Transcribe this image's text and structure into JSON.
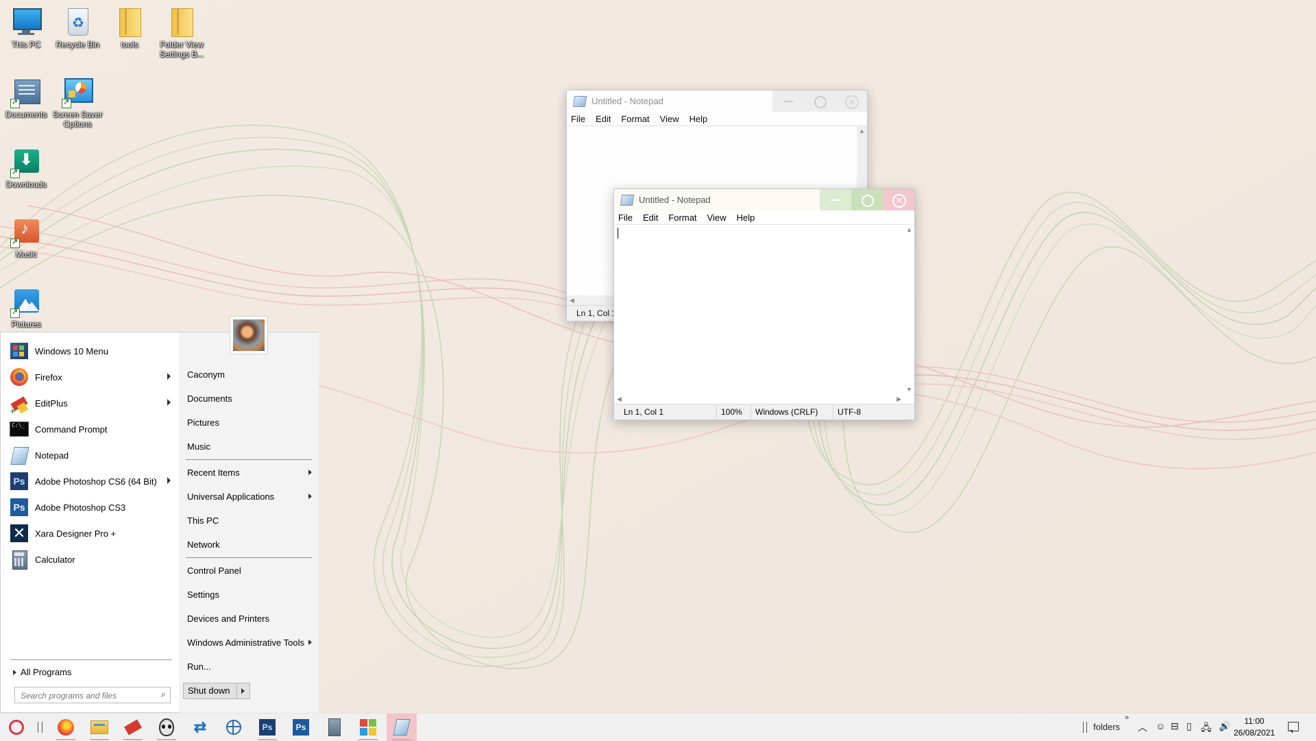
{
  "desktop_icons": [
    {
      "label": "This PC",
      "icon": "monitor-icon"
    },
    {
      "label": "Recycle Bin",
      "icon": "recycle-bin-icon"
    },
    {
      "label": "tools",
      "icon": "folder-icon"
    },
    {
      "label": "Folder View Settings B...",
      "icon": "folder-icon"
    },
    {
      "label": "Documents",
      "icon": "documents-icon"
    },
    {
      "label": "Screen Saver Options",
      "icon": "screen-saver-icon"
    },
    {
      "label": "Downloads",
      "icon": "downloads-icon"
    },
    {
      "label": "Music",
      "icon": "music-icon"
    },
    {
      "label": "Pictures",
      "icon": "pictures-icon"
    }
  ],
  "notepad_back": {
    "title": "Untitled - Notepad",
    "menu": [
      "File",
      "Edit",
      "Format",
      "View",
      "Help"
    ],
    "status_partial": "Ln 1, Col 1"
  },
  "notepad_front": {
    "title": "Untitled - Notepad",
    "menu": [
      "File",
      "Edit",
      "Format",
      "View",
      "Help"
    ],
    "status": {
      "position": "Ln 1, Col 1",
      "zoom": "100%",
      "line_ending": "Windows (CRLF)",
      "encoding": "UTF-8"
    }
  },
  "start_menu": {
    "programs": [
      {
        "label": "Windows 10 Menu",
        "icon": "windows-10-menu-icon",
        "submenu": false
      },
      {
        "label": "Firefox",
        "icon": "firefox-icon",
        "submenu": true
      },
      {
        "label": "EditPlus",
        "icon": "editplus-icon",
        "submenu": true
      },
      {
        "label": "Command Prompt",
        "icon": "command-prompt-icon",
        "submenu": false
      },
      {
        "label": "Notepad",
        "icon": "notepad-icon",
        "submenu": false
      },
      {
        "label": "Adobe Photoshop CS6 (64 Bit)",
        "icon": "photoshop-icon",
        "submenu": true
      },
      {
        "label": "Adobe Photoshop CS3",
        "icon": "photoshop-icon",
        "submenu": false
      },
      {
        "label": "Xara Designer Pro +",
        "icon": "xara-icon",
        "submenu": false
      },
      {
        "label": "Calculator",
        "icon": "calculator-icon",
        "submenu": false
      }
    ],
    "all_programs": "All Programs",
    "search_placeholder": "Search programs and files",
    "right_groups": [
      [
        {
          "label": "Caconym",
          "submenu": false
        },
        {
          "label": "Documents",
          "submenu": false
        },
        {
          "label": "Pictures",
          "submenu": false
        },
        {
          "label": "Music",
          "submenu": false
        }
      ],
      [
        {
          "label": "Recent Items",
          "submenu": true
        },
        {
          "label": "Universal Applications",
          "submenu": true
        },
        {
          "label": "This PC",
          "submenu": false
        },
        {
          "label": "Network",
          "submenu": false
        }
      ],
      [
        {
          "label": "Control Panel",
          "submenu": false
        },
        {
          "label": "Settings",
          "submenu": false
        },
        {
          "label": "Devices and Printers",
          "submenu": false
        },
        {
          "label": "Windows Administrative Tools",
          "submenu": true
        },
        {
          "label": "Run...",
          "submenu": false
        }
      ]
    ],
    "shutdown_label": "Shut down"
  },
  "taskbar": {
    "apps": [
      "start-orb-icon",
      "firefox-icon",
      "file-explorer-icon",
      "editplus-icon",
      "alien-icon",
      "sync-icon",
      "network-globe-icon",
      "photoshop-cs6-icon",
      "photoshop-cs3-icon",
      "calculator-icon",
      "windows-menu-icon",
      "notepad-icon"
    ],
    "toolbar_label": "folders",
    "toolbar_chevron": "»",
    "time": "11:00",
    "date": "26/08/2021"
  },
  "colors": {
    "close_red": "#e81123",
    "wallpaper_green": "#9fbf8a",
    "wallpaper_pink": "#e68a9a",
    "taskbar": "#f0f0f0"
  }
}
